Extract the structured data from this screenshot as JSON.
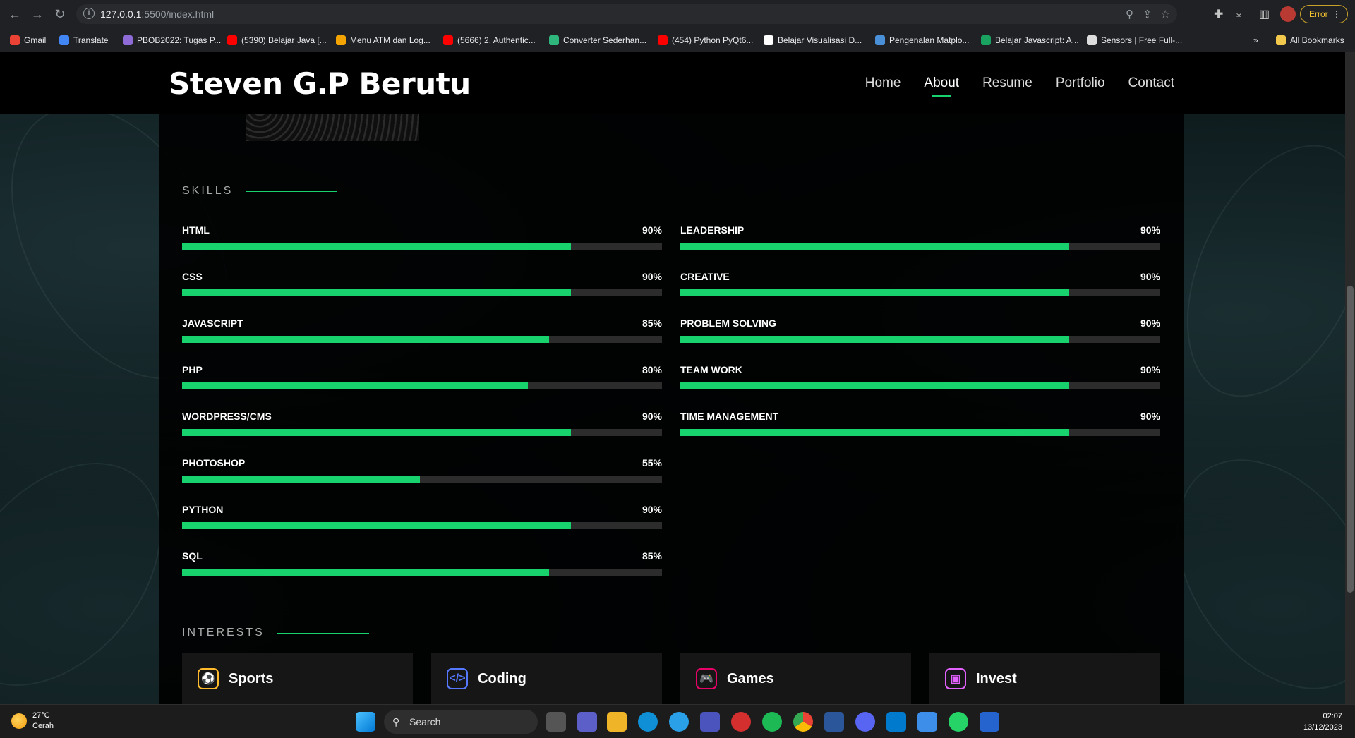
{
  "browser": {
    "url_host": "127.0.0.1",
    "url_rest": ":5500/index.html",
    "error_label": "Error",
    "bookmarks": [
      {
        "label": "Gmail",
        "color": "#ea4335"
      },
      {
        "label": "Translate",
        "color": "#4285f4"
      },
      {
        "label": "PBOB2022: Tugas P...",
        "color": "#8e6bd6"
      },
      {
        "label": "(5390) Belajar Java [...",
        "color": "#ff0000"
      },
      {
        "label": "Menu ATM dan Log...",
        "color": "#f4a400"
      },
      {
        "label": "(5666) 2. Authentic...",
        "color": "#ff0000"
      },
      {
        "label": "Converter Sederhan...",
        "color": "#2fb67c"
      },
      {
        "label": "(454) Python PyQt6...",
        "color": "#ff0000"
      },
      {
        "label": "Belajar Visualisasi D...",
        "color": "#ffffff"
      },
      {
        "label": "Pengenalan Matplo...",
        "color": "#4a90d9"
      },
      {
        "label": "Belajar Javascript: A...",
        "color": "#1aa260"
      },
      {
        "label": "Sensors | Free Full-...",
        "color": "#dddddd"
      }
    ],
    "all_bookmarks": "All Bookmarks"
  },
  "site": {
    "logo": "Steven G.P Berutu",
    "nav": [
      "Home",
      "About",
      "Resume",
      "Portfolio",
      "Contact"
    ],
    "active_nav": "About",
    "accent": "#18d26e"
  },
  "skills": {
    "title": "SKILLS",
    "left": [
      {
        "name": "HTML",
        "percent": 90
      },
      {
        "name": "CSS",
        "percent": 90
      },
      {
        "name": "JAVASCRIPT",
        "percent": 85
      },
      {
        "name": "PHP",
        "percent": 80
      },
      {
        "name": "WORDPRESS/CMS",
        "percent": 90
      },
      {
        "name": "PHOTOSHOP",
        "percent": 55
      },
      {
        "name": "PYTHON",
        "percent": 90
      },
      {
        "name": "SQL",
        "percent": 85
      }
    ],
    "right": [
      {
        "name": "LEADERSHIP",
        "percent": 90
      },
      {
        "name": "CREATIVE",
        "percent": 90
      },
      {
        "name": "PROBLEM SOLVING",
        "percent": 90
      },
      {
        "name": "TEAM WORK",
        "percent": 90
      },
      {
        "name": "TIME MANAGEMENT",
        "percent": 90
      }
    ]
  },
  "interests": {
    "title": "INTERESTS",
    "items": [
      {
        "label": "Sports",
        "icon": "sports-icon",
        "color": "#ffbb2c",
        "glyph": "⚽"
      },
      {
        "label": "Coding",
        "icon": "code-icon",
        "color": "#5578ff",
        "glyph": "</>"
      },
      {
        "label": "Games",
        "icon": "gamepad-icon",
        "color": "#e80368",
        "glyph": "🎮"
      },
      {
        "label": "Invest",
        "icon": "wallet-icon",
        "color": "#e361ff",
        "glyph": "▣"
      }
    ]
  },
  "taskbar": {
    "temp": "27°C",
    "condition": "Cerah",
    "search": "Search",
    "time": "02:07",
    "date": "13/12/2023"
  }
}
